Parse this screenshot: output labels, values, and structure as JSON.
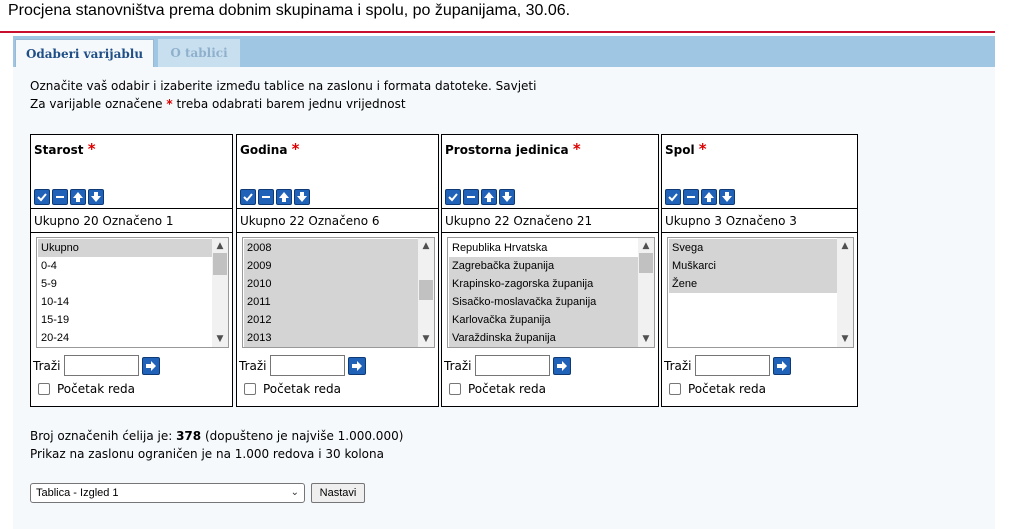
{
  "page_title": "Procjena stanovništva prema dobnim skupinama i spolu, po županijama, 30.06.",
  "tabs": [
    {
      "label": "Odaberi varijablu",
      "active": true
    },
    {
      "label": "O tablici",
      "active": false
    }
  ],
  "instructions": {
    "line1": "Označite vaš odabir i izaberite između tablice na zaslonu i formata datoteke. Savjeti",
    "line2_pre": "Za varijable označene",
    "line2_star": "*",
    "line2_post": "treba odabrati barem jednu vrijednost"
  },
  "variables": [
    {
      "name": "Starost",
      "required_mark": "*",
      "count_text": "Ukupno 20 Označeno 1",
      "items": [
        {
          "label": "Ukupno",
          "selected": true
        },
        {
          "label": "0-4",
          "selected": false
        },
        {
          "label": "5-9",
          "selected": false
        },
        {
          "label": "10-14",
          "selected": false
        },
        {
          "label": "15-19",
          "selected": false
        },
        {
          "label": "20-24",
          "selected": false
        }
      ],
      "search_label": "Traži",
      "search_value": "",
      "checkbox_label": "Početak reda"
    },
    {
      "name": "Godina",
      "required_mark": "*",
      "count_text": "Ukupno 22 Označeno 6",
      "items": [
        {
          "label": "2008",
          "selected": true
        },
        {
          "label": "2009",
          "selected": true
        },
        {
          "label": "2010",
          "selected": true
        },
        {
          "label": "2011",
          "selected": true
        },
        {
          "label": "2012",
          "selected": true
        },
        {
          "label": "2013",
          "selected": true
        }
      ],
      "search_label": "Traži",
      "search_value": "",
      "checkbox_label": "Početak reda"
    },
    {
      "name": "Prostorna jedinica",
      "required_mark": "*",
      "count_text": "Ukupno 22 Označeno 21",
      "items": [
        {
          "label": "Republika Hrvatska",
          "selected": false
        },
        {
          "label": "Zagrebačka županija",
          "selected": true
        },
        {
          "label": "Krapinsko-zagorska županija",
          "selected": true
        },
        {
          "label": "Sisačko-moslavačka županija",
          "selected": true
        },
        {
          "label": "Karlovačka županija",
          "selected": true
        },
        {
          "label": "Varaždinska županija",
          "selected": true
        }
      ],
      "search_label": "Traži",
      "search_value": "",
      "checkbox_label": "Početak reda"
    },
    {
      "name": "Spol",
      "required_mark": "*",
      "count_text": "Ukupno 3 Označeno 3",
      "items": [
        {
          "label": "Svega",
          "selected": true
        },
        {
          "label": "Muškarci",
          "selected": true
        },
        {
          "label": "Žene",
          "selected": true
        }
      ],
      "search_label": "Traži",
      "search_value": "",
      "checkbox_label": "Početak reda"
    }
  ],
  "list_buttons": [
    "select-all-icon",
    "deselect-all-icon",
    "sort-ascending-icon",
    "sort-descending-icon"
  ],
  "summary": {
    "cells_pre": "Broj označenih ćelija je:",
    "cells_value": "378",
    "cells_post": "(dopušteno je najviše 1.000.000)",
    "limit_note": "Prikaz na zaslonu ograničen je na 1.000 redova i 30 kolona"
  },
  "output_select": {
    "value": "Tablica - Izgled 1"
  },
  "continue_button": "Nastavi",
  "colors": {
    "accent": "#c8102e",
    "tab_bar": "#9fc7e3",
    "icon_button": "#1f62b8",
    "selected_item": "#d4d4d4"
  }
}
